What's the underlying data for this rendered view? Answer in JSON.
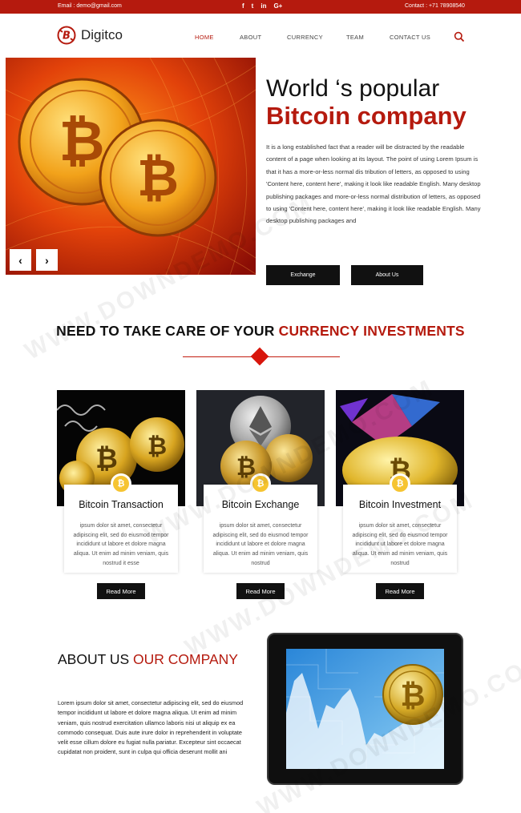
{
  "topbar": {
    "email": "Email : demo@gmail.com",
    "social": [
      "f",
      "t",
      "in",
      "G+"
    ],
    "contact": "Contact : +71 78908540"
  },
  "header": {
    "logo_text": "Digitco",
    "nav": [
      "HOME",
      "ABOUT",
      "CURRENCY",
      "TEAM",
      "CONTACT US"
    ],
    "active_nav": "HOME",
    "search_icon": "search-icon"
  },
  "hero": {
    "title_line1": "World ‘s popular",
    "title_line2": "Bitcoin company",
    "paragraph": "It is a long established fact that a reader will be distracted by the readable content of a page when looking at its layout. The point of using Lorem Ipsum is that it has a more-or-less normal dis tribution of letters, as opposed to using 'Content here, content here', making it look like readable English. Many desktop publishing packages and more-or-less normal distribution of letters, as opposed to using 'Content here, content here', making it look like readable English. Many desktop publishing packages and",
    "buttons": [
      "Exchange",
      "About Us"
    ],
    "prev_arrow": "‹",
    "next_arrow": "›"
  },
  "section": {
    "title_plain": "NEED TO TAKE CARE OF YOUR ",
    "title_red": "CURRENCY INVESTMENTS"
  },
  "cards": [
    {
      "title": "Bitcoin Transaction",
      "text": "ipsum dolor sit amet, consectetur adipiscing elit, sed do eiusmod tempor incididunt ut labore et dolore magna aliqua. Ut enim ad minim veniam, quis nostrud it esse",
      "button": "Read More"
    },
    {
      "title": "Bitcoin Exchange",
      "text": "ipsum dolor sit amet, consectetur adipiscing elit, sed do eiusmod tempor incididunt ut labore et dolore magna aliqua. Ut enim ad minim veniam, quis nostrud",
      "button": "Read More"
    },
    {
      "title": "Bitcoin Investment",
      "text": "ipsum dolor sit amet, consectetur adipiscing elit, sed do eiusmod tempor incididunt ut labore et dolore magna aliqua. Ut enim ad minim veniam, quis nostrud",
      "button": "Read More"
    }
  ],
  "about": {
    "title_plain": "ABOUT US ",
    "title_red": "OUR COMPANY",
    "paragraph": "Lorem ipsum dolor sit amet, consectetur adipiscing elit, sed do eiusmod tempor incididunt ut labore et dolore magna aliqua. Ut enim ad minim veniam, quis nostrud exercitation ullamco laboris nisi ut aliquip ex ea commodo consequat. Duis aute irure dolor in reprehenderit in voluptate velit esse cillum dolore eu fugiat nulla pariatur. Excepteur sint occaecat cupidatat non proident, sunt in culpa qui officia deserunt mollit ani"
  },
  "watermark": "WWW.DOWNDEMO.COM",
  "colors": {
    "brand_red": "#b51a0e",
    "button_black": "#111111",
    "badge_gold": "#f6c431"
  }
}
